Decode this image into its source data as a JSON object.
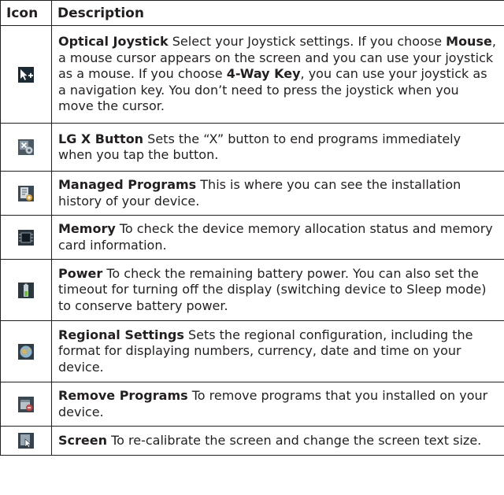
{
  "header": {
    "icon": "Icon",
    "description": "Description"
  },
  "rows": [
    {
      "icon": "pointer-plus-icon",
      "title": "Optical Joystick",
      "t1": " Select your Joystick settings. If you choose ",
      "b1": "Mouse",
      "t2": ", a mouse cursor appears on the screen and you can use your joystick as a mouse. If you choose ",
      "b2": "4-Way Key",
      "t3": ", you can use your joystick as a navigation key. You don’t need to press the joystick when you move the cursor."
    },
    {
      "icon": "x-button-gear-icon",
      "title": "LG X Button",
      "text": " Sets the “X” button to end programs immediately when you tap the button."
    },
    {
      "icon": "managed-programs-icon",
      "title": "Managed Programs",
      "text": " This is where you can see the installation history of your device."
    },
    {
      "icon": "memory-chip-icon",
      "title": "Memory",
      "text": " To check the device memory allocation status and memory card information."
    },
    {
      "icon": "battery-power-icon",
      "title": "Power",
      "text": " To check the remaining battery power. You can also set the timeout for turning off the display (switching device to Sleep mode) to conserve battery power."
    },
    {
      "icon": "globe-icon",
      "title": "Regional Settings",
      "text": " Sets the regional configuration, including the format for displaying numbers, currency, date and time on your device."
    },
    {
      "icon": "remove-programs-icon",
      "title": "Remove Programs",
      "text": " To remove programs that you installed on your device."
    },
    {
      "icon": "screen-calibrate-icon",
      "title": "Screen",
      "text": " To re-calibrate the screen and change the screen text size."
    }
  ]
}
